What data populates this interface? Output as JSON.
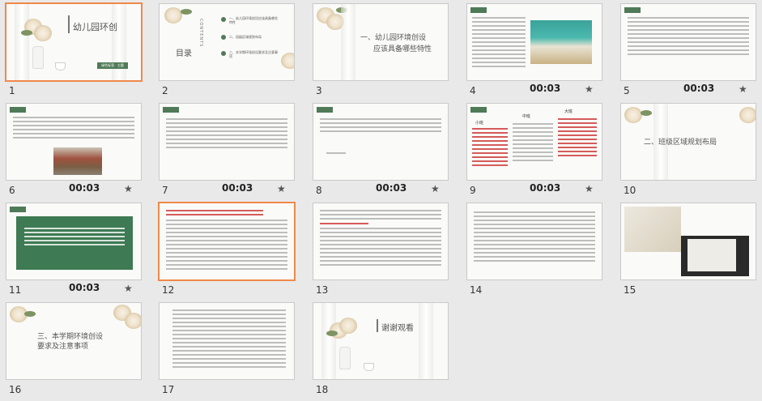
{
  "slides": [
    {
      "num": "1",
      "timing": "",
      "star": "",
      "title": "幼儿园环创",
      "sub": "绿色标签 · 主题"
    },
    {
      "num": "2",
      "timing": "",
      "star": "",
      "title": "目录",
      "vertical": "CONTENTS",
      "items": [
        "一、幼儿园环境创设应该具备哪些特性",
        "二、班级区域规划布局",
        "三、本学期环境创设要求及注意事项"
      ]
    },
    {
      "num": "3",
      "timing": "",
      "star": "",
      "title": "一、幼儿园环境创设",
      "title2": "应该具备哪些特性"
    },
    {
      "num": "4",
      "timing": "00:03",
      "star": "★"
    },
    {
      "num": "5",
      "timing": "00:03",
      "star": "★"
    },
    {
      "num": "6",
      "timing": "00:03",
      "star": "★"
    },
    {
      "num": "7",
      "timing": "00:03",
      "star": "★"
    },
    {
      "num": "8",
      "timing": "00:03",
      "star": "★"
    },
    {
      "num": "9",
      "timing": "00:03",
      "star": "★",
      "labels": [
        "小班",
        "中班",
        "大班"
      ]
    },
    {
      "num": "10",
      "timing": "",
      "star": "",
      "title": "二、班级区域规划布局"
    },
    {
      "num": "11",
      "timing": "00:03",
      "star": "★"
    },
    {
      "num": "12",
      "timing": "",
      "star": ""
    },
    {
      "num": "13",
      "timing": "",
      "star": ""
    },
    {
      "num": "14",
      "timing": "",
      "star": ""
    },
    {
      "num": "15",
      "timing": "",
      "star": ""
    },
    {
      "num": "16",
      "timing": "",
      "star": "",
      "title": "三、本学期环境创设",
      "title2": "要求及注意事项"
    },
    {
      "num": "17",
      "timing": "",
      "star": ""
    },
    {
      "num": "18",
      "timing": "",
      "star": "",
      "title": "谢谢观看"
    }
  ],
  "colors": {
    "selected": "#f0884a",
    "green": "#4f7a58",
    "red": "#c33333",
    "background": "#e9e9e9"
  }
}
